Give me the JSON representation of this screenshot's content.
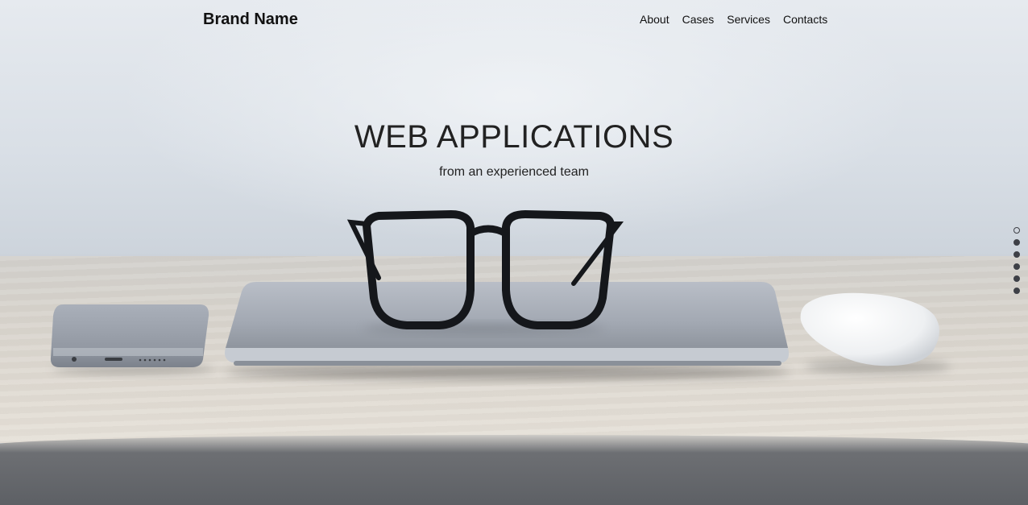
{
  "nav": {
    "brand": "Brand Name",
    "links": [
      {
        "label": "About"
      },
      {
        "label": "Cases"
      },
      {
        "label": "Services"
      },
      {
        "label": "Contacts"
      }
    ]
  },
  "hero": {
    "title": "WEB APPLICATIONS",
    "subtitle": "from an experienced team"
  },
  "slider": {
    "total_slides": 6,
    "active_index": 0
  }
}
